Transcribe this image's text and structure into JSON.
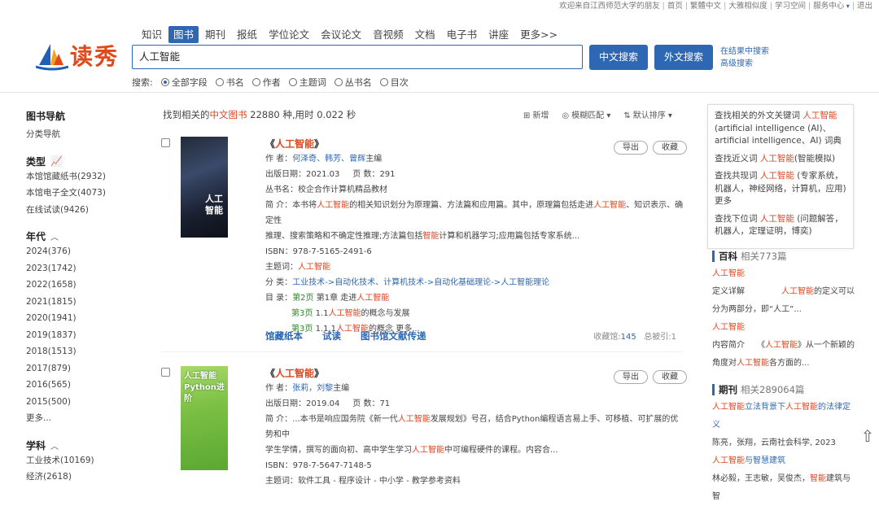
{
  "topbar": {
    "welcome": "欢迎来自江西师范大学的朋友",
    "links": [
      "首页",
      "繁體中文",
      "大雅相似度",
      "学习空间"
    ],
    "service": "服务中心",
    "logout": "退出"
  },
  "logo": {
    "text": "读秀"
  },
  "tabs": [
    {
      "label": "知识",
      "active": false
    },
    {
      "label": "图书",
      "active": true
    },
    {
      "label": "期刊",
      "active": false
    },
    {
      "label": "报纸",
      "active": false
    },
    {
      "label": "学位论文",
      "active": false
    },
    {
      "label": "会议论文",
      "active": false
    },
    {
      "label": "音视频",
      "active": false
    },
    {
      "label": "文档",
      "active": false
    },
    {
      "label": "电子书",
      "active": false
    },
    {
      "label": "讲座",
      "active": false
    },
    {
      "label": "更多>>",
      "active": false
    }
  ],
  "search": {
    "value": "人工智能",
    "btn_cn": "中文搜索",
    "btn_en": "外文搜索",
    "in_results": "在结果中搜索",
    "advanced": "高级搜索"
  },
  "scope": {
    "label": "搜索:",
    "options": [
      "全部字段",
      "书名",
      "作者",
      "主题词",
      "丛书名",
      "目次"
    ],
    "selected": 0
  },
  "leftnav": {
    "title": "图书导航",
    "sub": "分类导航",
    "type_title": "类型",
    "types": [
      "本馆馆藏纸书(2932)",
      "本馆电子全文(4073)",
      "在线试读(9426)"
    ],
    "year_title": "年代",
    "years": [
      "2024(376)",
      "2023(1742)",
      "2022(1658)",
      "2021(1815)",
      "2020(1941)",
      "2019(1837)",
      "2018(1513)",
      "2017(879)",
      "2016(565)",
      "2015(500)",
      "更多..."
    ],
    "subject_title": "学科",
    "subjects": [
      "工业技术(10169)",
      "经济(2618)"
    ]
  },
  "summary": {
    "prefix": "找到相关的",
    "kind": "中文图书",
    "count": "22880",
    "suffix": "种,用时 0.022 秒"
  },
  "sorters": {
    "add": "新增",
    "fuzzy": "模糊匹配",
    "sort": "默认排序"
  },
  "records": [
    {
      "title_pre": "《",
      "title_hl": "人工智能",
      "title_post": "》",
      "author_label": "作 者：",
      "authors": "何泽奇、韩芳、曾辉",
      "author_role": "主编",
      "date": "出版日期：2021.03",
      "pages": "页 数：291",
      "series": "丛书名：校企合作计算机精品教材",
      "abstract_a": "简 介：本书将",
      "abstract_b": "人工智能",
      "abstract_c": "的相关知识划分为原理篇、方法篇和应用篇。其中，原理篇包括走进",
      "abstract_d": "人工智能",
      "abstract_e": "、知识表示、确定性",
      "abstract_f": "推理、搜索策略和不确定性推理;方法篇包括",
      "abstract_g": "智能",
      "abstract_h": "计算和机器学习;应用篇包括专家系统...",
      "isbn": "ISBN：978-7-5165-2491-6",
      "subject_label": "主题词：",
      "subject": "人工智能",
      "class_label": "分 类：",
      "classes": [
        "工业技术",
        "自动化技术、计算机技术",
        "自动化基础理论",
        "人工智能理论"
      ],
      "toc_label": "目 录：",
      "toc": [
        {
          "page": "第2页",
          "pre": "第1章 走进",
          "hl": "人工智能",
          "post": ""
        },
        {
          "page": "第3页",
          "pre": "1.1",
          "hl": "人工智能",
          "post": "的概念与发展"
        },
        {
          "page": "第3页",
          "pre": "1.1.1",
          "hl": "人工智能",
          "post": "的概念 更多..."
        }
      ],
      "actions": [
        "馆藏纸本",
        "试读",
        "图书馆文献传递"
      ],
      "holdings_label": "收藏馆:",
      "holdings": "145",
      "cited": "总被引:1",
      "cover_title": "人工智能"
    },
    {
      "title_pre": "《",
      "title_hl": "人工智能",
      "title_post": "》",
      "author_label": "作 者：",
      "authors": "张莉，刘黎",
      "author_role": "主编",
      "date": "出版日期：2019.04",
      "pages": "页 数：71",
      "abstract_a": "简 介：...本书是响应国务院《新一代",
      "abstract_b": "人工智能",
      "abstract_c": "发展规划》号召，结合Python编程语言易上手、可移植、可扩展的优势和中",
      "abstract_d": "学生学情，撰写的面向初、高中学生学习",
      "abstract_e": "人工智能",
      "abstract_f": "中可编程硬件的课程。内容合...",
      "isbn": "ISBN：978-7-5647-7148-5",
      "subject_line": "主题词：软件工具 - 程序设计 - 中小学 - 教学参考资料",
      "cover_title": "人工智能 Python进阶"
    }
  ],
  "record_buttons": {
    "export": "导出",
    "favorite": "收藏"
  },
  "related": {
    "g1_pre": "查找相关的外文关键词",
    "g1_hl": "人工智能",
    "g1_post": "(artificial intelligence (AI)、artificial intelligence、AI) 词典",
    "g2_pre": "查找近义词",
    "g2_hl": "人工智能",
    "g2_post": "(智能模拟)",
    "g3_pre": "查找共现词",
    "g3_hl": "人工智能",
    "g3_post": "(专家系统，机器人，神经网络，计算机，应用) 更多",
    "g4_pre": "查找下位词",
    "g4_hl": "人工智能",
    "g4_post": "(问题解答，机器人，定理证明，博奕)"
  },
  "baike": {
    "title": "百科",
    "count": "相关773篇",
    "l1": "人工智能",
    "l2_left": "定义详解",
    "l2_hl": "人工智能",
    "l2_right": "的定义可以",
    "l3": "分为两部分，即“人工”...",
    "l4": "人工智能",
    "l5_left": "内容简介",
    "l5_mid": "《",
    "l5_hl": "人工智能",
    "l5_right": "》从一个新颖的",
    "l6_pre": "角度对",
    "l6_hl": "人工智能",
    "l6_post": "各方面的..."
  },
  "journal": {
    "title": "期刊",
    "count": "相关289064篇",
    "l1_a": "人工智能",
    "l1_b": "立法背景下",
    "l1_c": "人工智能",
    "l1_d": "的法律定义",
    "l2": "陈亮，张翔，云南社会科学, 2023",
    "l3_a": "人工智能",
    "l3_b": "与智慧建筑",
    "l4_pre": "林必毅，王志敏，吴俊杰，",
    "l4_hl": "智能",
    "l4_post": "建筑与智"
  },
  "colors": {
    "brand_blue": "#2e67b2",
    "highlight_red": "#e0451e",
    "logo_orange": "#e04a1a"
  }
}
